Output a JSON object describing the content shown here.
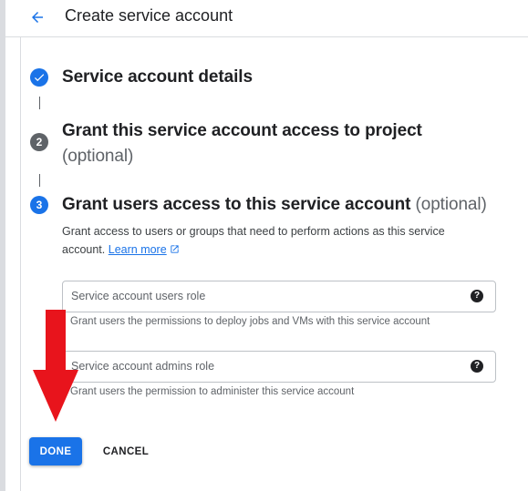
{
  "header": {
    "title": "Create service account",
    "back_icon": "arrow-back-icon"
  },
  "steps": [
    {
      "indicator": "check",
      "title": "Service account details",
      "optional": ""
    },
    {
      "number": "2",
      "title": "Grant this service account access to project",
      "optional": "(optional)"
    },
    {
      "number": "3",
      "title": "Grant users access to this service account",
      "optional": "(optional)"
    }
  ],
  "step3": {
    "description": "Grant access to users or groups that need to perform actions as this service account.",
    "learn_more": "Learn more",
    "fields": [
      {
        "label": "Service account users role",
        "helper": "Grant users the permissions to deploy jobs and VMs with this service account"
      },
      {
        "label": "Service account admins role",
        "helper": "Grant users the permission to administer this service account"
      }
    ]
  },
  "actions": {
    "done": "DONE",
    "cancel": "CANCEL"
  },
  "colors": {
    "primary": "#1a73e8",
    "step_inactive": "#5f6368",
    "annotation_arrow": "#e8141c"
  },
  "icons": {
    "check": "check-icon",
    "help": "help-icon",
    "external_link": "open-in-new-icon",
    "annotation": "red-arrow-annotation"
  }
}
